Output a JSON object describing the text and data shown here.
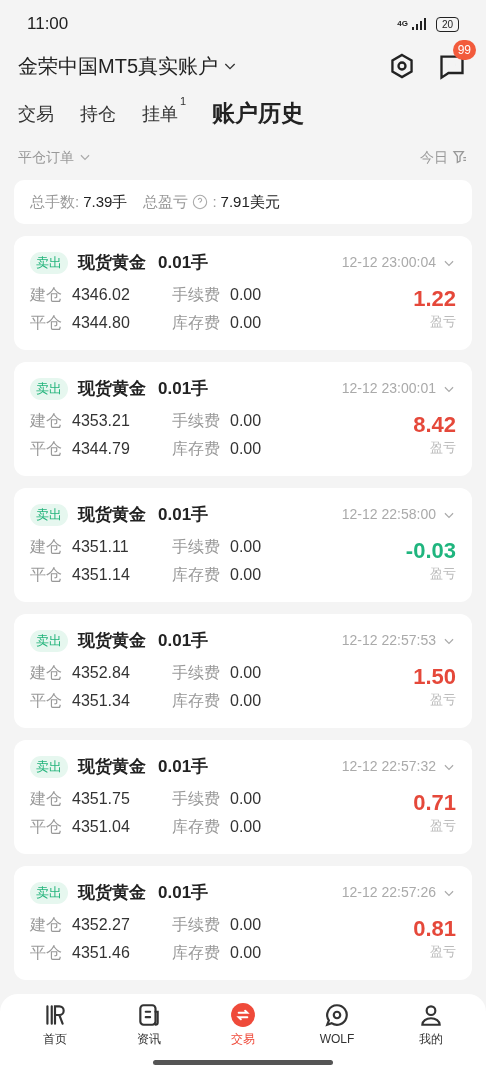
{
  "status_bar": {
    "time": "11:00",
    "network": "4G",
    "battery": "20"
  },
  "header": {
    "account": "金荣中国MT5真实账户",
    "message_badge": "99"
  },
  "tabs": [
    {
      "label": "交易",
      "selected": false
    },
    {
      "label": "持仓",
      "selected": false
    },
    {
      "label": "挂单",
      "badge": "1",
      "selected": false
    },
    {
      "label": "账户历史",
      "selected": true
    }
  ],
  "filter": {
    "type": "平仓订单",
    "period": "今日"
  },
  "summary": {
    "lots_label": "总手数:",
    "lots": "7.39手",
    "pnl_label": "总盈亏",
    "pnl_colon": ":",
    "pnl": "7.91美元"
  },
  "orders": [
    {
      "side": "卖出",
      "product": "现货黄金",
      "volume": "0.01手",
      "time": "12-12 23:00:04",
      "open_label": "建仓",
      "open": "4346.02",
      "close_label": "平仓",
      "close": "4344.80",
      "fee_label": "手续费",
      "fee": "0.00",
      "swap_label": "库存费",
      "swap": "0.00",
      "pnl": "1.22",
      "pnl_label": "盈亏",
      "kind": "gain"
    },
    {
      "side": "卖出",
      "product": "现货黄金",
      "volume": "0.01手",
      "time": "12-12 23:00:01",
      "open_label": "建仓",
      "open": "4353.21",
      "close_label": "平仓",
      "close": "4344.79",
      "fee_label": "手续费",
      "fee": "0.00",
      "swap_label": "库存费",
      "swap": "0.00",
      "pnl": "8.42",
      "pnl_label": "盈亏",
      "kind": "gain"
    },
    {
      "side": "卖出",
      "product": "现货黄金",
      "volume": "0.01手",
      "time": "12-12 22:58:00",
      "open_label": "建仓",
      "open": "4351.11",
      "close_label": "平仓",
      "close": "4351.14",
      "fee_label": "手续费",
      "fee": "0.00",
      "swap_label": "库存费",
      "swap": "0.00",
      "pnl": "-0.03",
      "pnl_label": "盈亏",
      "kind": "loss"
    },
    {
      "side": "卖出",
      "product": "现货黄金",
      "volume": "0.01手",
      "time": "12-12 22:57:53",
      "open_label": "建仓",
      "open": "4352.84",
      "close_label": "平仓",
      "close": "4351.34",
      "fee_label": "手续费",
      "fee": "0.00",
      "swap_label": "库存费",
      "swap": "0.00",
      "pnl": "1.50",
      "pnl_label": "盈亏",
      "kind": "gain"
    },
    {
      "side": "卖出",
      "product": "现货黄金",
      "volume": "0.01手",
      "time": "12-12 22:57:32",
      "open_label": "建仓",
      "open": "4351.75",
      "close_label": "平仓",
      "close": "4351.04",
      "fee_label": "手续费",
      "fee": "0.00",
      "swap_label": "库存费",
      "swap": "0.00",
      "pnl": "0.71",
      "pnl_label": "盈亏",
      "kind": "gain"
    },
    {
      "side": "卖出",
      "product": "现货黄金",
      "volume": "0.01手",
      "time": "12-12 22:57:26",
      "open_label": "建仓",
      "open": "4352.27",
      "close_label": "平仓",
      "close": "4351.46",
      "fee_label": "手续费",
      "fee": "0.00",
      "swap_label": "库存费",
      "swap": "0.00",
      "pnl": "0.81",
      "pnl_label": "盈亏",
      "kind": "gain"
    }
  ],
  "nav": [
    {
      "label": "首页",
      "kind": "logo",
      "selected": false
    },
    {
      "label": "资讯",
      "kind": "news",
      "selected": false
    },
    {
      "label": "交易",
      "kind": "trade",
      "selected": true
    },
    {
      "label": "WOLF",
      "kind": "chat",
      "selected": false
    },
    {
      "label": "我的",
      "kind": "user",
      "selected": false
    }
  ]
}
